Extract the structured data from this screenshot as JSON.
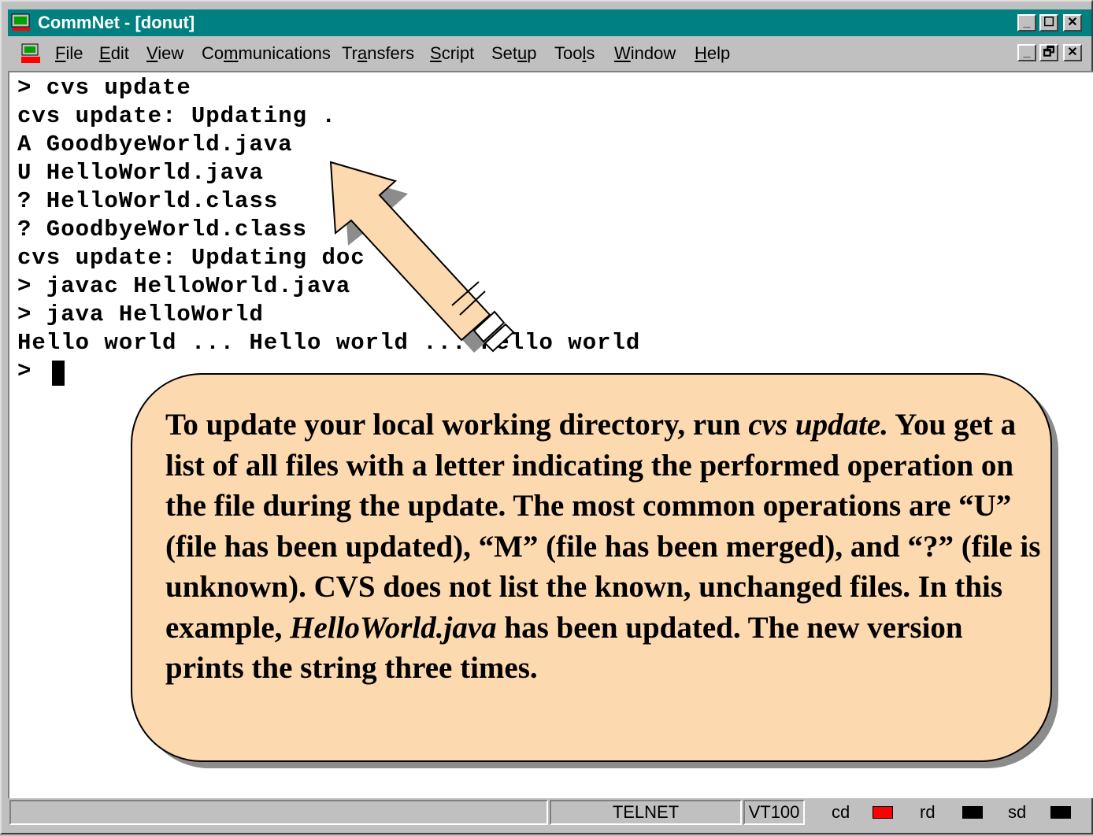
{
  "window": {
    "title": "CommNet - [donut]",
    "buttons": {
      "minimize": "_",
      "restore": "☐",
      "close": "✕",
      "doc_minimize": "_",
      "doc_restore": "🗗",
      "doc_close": "✕"
    }
  },
  "menubar": {
    "items": [
      {
        "label": "File",
        "accel": "F"
      },
      {
        "label": "Edit",
        "accel": "E"
      },
      {
        "label": "View",
        "accel": "V"
      },
      {
        "label": "Communications",
        "accel": "m"
      },
      {
        "label": "Transfers",
        "accel": "a"
      },
      {
        "label": "Script",
        "accel": "S"
      },
      {
        "label": "Setup",
        "accel": "u"
      },
      {
        "label": "Tools",
        "accel": "l"
      },
      {
        "label": "Window",
        "accel": "W"
      },
      {
        "label": "Help",
        "accel": "H"
      }
    ]
  },
  "terminal": {
    "lines": [
      "> cvs update",
      "cvs update: Updating .",
      "A GoodbyeWorld.java",
      "U HelloWorld.java",
      "? HelloWorld.class",
      "? GoodbyeWorld.class",
      "cvs update: Updating doc",
      "> javac HelloWorld.java",
      "> java HelloWorld",
      "Hello world ... Hello world ... Hello world",
      "> "
    ]
  },
  "callout": {
    "segments": [
      {
        "text": "To update your local working directory, run ",
        "italic": false
      },
      {
        "text": "cvs update.",
        "italic": true
      },
      {
        "text": " You get a list of all files with a letter indicating the performed operation on the file during the update. The most common operations are “U” (file has been updated), “M” (file has been merged), and “?” (file is unknown). CVS does not list the known, unchanged files. In this example, ",
        "italic": false
      },
      {
        "text": "HelloWorld.java",
        "italic": true
      },
      {
        "text": " has been updated. The new version prints the string three times.",
        "italic": false
      }
    ]
  },
  "statusbar": {
    "protocol": "TELNET",
    "emulation": "VT100",
    "indicators": [
      {
        "label": "cd",
        "color": "#ff0000"
      },
      {
        "label": "rd",
        "color": "#000000"
      },
      {
        "label": "sd",
        "color": "#000000"
      }
    ]
  },
  "colors": {
    "titlebar": "#008080",
    "callout_fill": "#fdd9b0",
    "arrow_fill": "#fdd9b0"
  }
}
